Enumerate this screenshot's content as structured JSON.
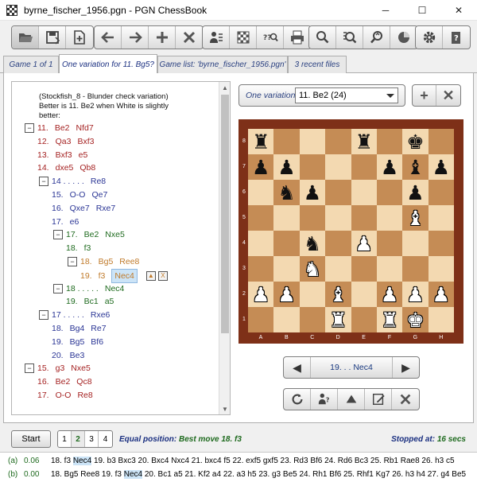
{
  "window": {
    "title": "byrne_fischer_1956.pgn - PGN ChessBook",
    "minimize": "─",
    "maximize": "☐",
    "close": "✕"
  },
  "toolbar": {
    "groups": [
      [
        "open-icon",
        "save-icon",
        "new-game-icon"
      ],
      [
        "back-icon",
        "forward-icon",
        "add-icon",
        "delete-icon"
      ],
      [
        "players-icon",
        "board-icon",
        "search-position-icon",
        "print-icon"
      ],
      [
        "zoom-icon",
        "analyze-icon",
        "explore-icon",
        "stats-icon"
      ],
      [
        "settings-icon",
        "help-icon"
      ]
    ]
  },
  "tabs": [
    {
      "label": "Game 1 of 1",
      "active": false
    },
    {
      "label": "One variation for 11. Bg5?",
      "active": true
    },
    {
      "label": "Game list: 'byrne_fischer_1956.pgn'",
      "active": false
    },
    {
      "label": "3 recent files",
      "active": false
    }
  ],
  "notation": {
    "comment": "(Stockfish_8 - Blunder check variation) Better is  11. Be2  when White is slightly better:",
    "lines": [
      {
        "indent": 0,
        "box": "−",
        "color": "red",
        "moves": [
          "11.",
          "Be2",
          "Nfd7"
        ]
      },
      {
        "indent": 0,
        "box": "",
        "color": "red",
        "moves": [
          "12.",
          "Qa3",
          "Bxf3"
        ]
      },
      {
        "indent": 0,
        "box": "",
        "color": "red",
        "moves": [
          "13.",
          "Bxf3",
          "e5"
        ]
      },
      {
        "indent": 0,
        "box": "",
        "color": "red",
        "moves": [
          "14.",
          "dxe5",
          "Qb8"
        ]
      },
      {
        "indent": 1,
        "box": "−",
        "color": "blue",
        "moves": [
          "14 . . . . .",
          "Re8"
        ]
      },
      {
        "indent": 1,
        "box": "",
        "color": "blue",
        "moves": [
          "15.",
          "O-O",
          "Qe7"
        ]
      },
      {
        "indent": 1,
        "box": "",
        "color": "blue",
        "moves": [
          "16.",
          "Qxe7",
          "Rxe7"
        ]
      },
      {
        "indent": 1,
        "box": "",
        "color": "blue",
        "moves": [
          "17.",
          "e6"
        ]
      },
      {
        "indent": 2,
        "box": "−",
        "color": "green",
        "moves": [
          "17.",
          "Be2",
          "Nxe5"
        ]
      },
      {
        "indent": 2,
        "box": "",
        "color": "green",
        "moves": [
          "18.",
          "f3"
        ]
      },
      {
        "indent": 3,
        "box": "−",
        "color": "orange",
        "moves": [
          "18.",
          "Bg5",
          "Ree8"
        ]
      },
      {
        "indent": 3,
        "box": "",
        "color": "orange",
        "moves": [
          "19.",
          "f3",
          "Nec4"
        ],
        "current": true
      },
      {
        "indent": 2,
        "box": "−",
        "color": "green",
        "moves": [
          "18 . . . . .",
          "Nec4"
        ]
      },
      {
        "indent": 2,
        "box": "",
        "color": "green",
        "moves": [
          "19.",
          "Bc1",
          "a5"
        ]
      },
      {
        "indent": 1,
        "box": "−",
        "color": "blue",
        "moves": [
          "17 . . . . .",
          "Rxe6"
        ]
      },
      {
        "indent": 1,
        "box": "",
        "color": "blue",
        "moves": [
          "18.",
          "Bg4",
          "Re7"
        ]
      },
      {
        "indent": 1,
        "box": "",
        "color": "blue",
        "moves": [
          "19.",
          "Bg5",
          "Bf6"
        ]
      },
      {
        "indent": 1,
        "box": "",
        "color": "blue",
        "moves": [
          "20.",
          "Be3"
        ]
      },
      {
        "indent": 0,
        "box": "−",
        "color": "red",
        "moves": [
          "15.",
          "g3",
          "Nxe5"
        ]
      },
      {
        "indent": 0,
        "box": "",
        "color": "red",
        "moves": [
          "16.",
          "Be2",
          "Qc8"
        ]
      },
      {
        "indent": 0,
        "box": "",
        "color": "red",
        "moves": [
          "17.",
          "O-O",
          "Re8"
        ]
      }
    ],
    "up_button": "▲",
    "close_button": "X"
  },
  "variation": {
    "label": "One variation",
    "selected": "11.  Be2  (24)",
    "add_label": "+",
    "remove_label": "✕"
  },
  "board": {
    "ranks": [
      "8",
      "7",
      "6",
      "5",
      "4",
      "3",
      "2",
      "1"
    ],
    "files": [
      "A",
      "B",
      "C",
      "D",
      "E",
      "F",
      "G",
      "H"
    ],
    "position": [
      [
        "r",
        "",
        "",
        "",
        "r",
        "",
        "k",
        ""
      ],
      [
        "p",
        "p",
        "",
        "",
        "",
        "p",
        "b",
        "p"
      ],
      [
        "",
        "n",
        "p",
        "",
        "",
        "",
        "p",
        ""
      ],
      [
        "",
        "",
        "",
        "",
        "",
        "",
        "B",
        ""
      ],
      [
        "",
        "",
        "n",
        "",
        "P",
        "",
        "",
        ""
      ],
      [
        "",
        "",
        "N",
        "",
        "",
        "",
        "",
        ""
      ],
      [
        "P",
        "P",
        "",
        "B",
        "",
        "P",
        "P",
        "P"
      ],
      [
        "",
        "",
        "",
        "R",
        "",
        "R",
        "K",
        ""
      ]
    ]
  },
  "navigator": {
    "prev": "◀",
    "move": "19. . .  Nec4",
    "next": "▶"
  },
  "actions": [
    "refresh-icon",
    "ask-engine-icon",
    "move-up-icon",
    "edit-icon",
    "delete-icon"
  ],
  "engine": {
    "start_label": "Start",
    "pv_buttons": [
      "1",
      "2",
      "3",
      "4"
    ],
    "pv_selected": 1,
    "status_label": "Equal position:",
    "status_value": "Best move  18. f3",
    "stopped_label": "Stopped at:",
    "stopped_value": "16 secs"
  },
  "analysis": [
    {
      "tag": "(a)",
      "score": "0.06",
      "pre": "18. f3",
      "hl": "Nec4",
      "post": "19. b3 Bxc3  20. Bxc4 Nxc4  21. bxc4 f5  22. exf5 gxf5  23. Rd3 Bf6  24. Rd6 Bc3  25. Rb1 Rae8  26. h3 c5"
    },
    {
      "tag": "(b)",
      "score": "0.00",
      "pre": "18. Bg5 Ree8  19. f3",
      "hl": "Nec4",
      "post": "20. Bc1 a5  21. Kf2 a4  22. a3 h5  23. g3 Be5  24. Rh1 Bf6  25. Rhf1 Kg7  26. h3 h4  27. g4 Be5"
    }
  ]
}
